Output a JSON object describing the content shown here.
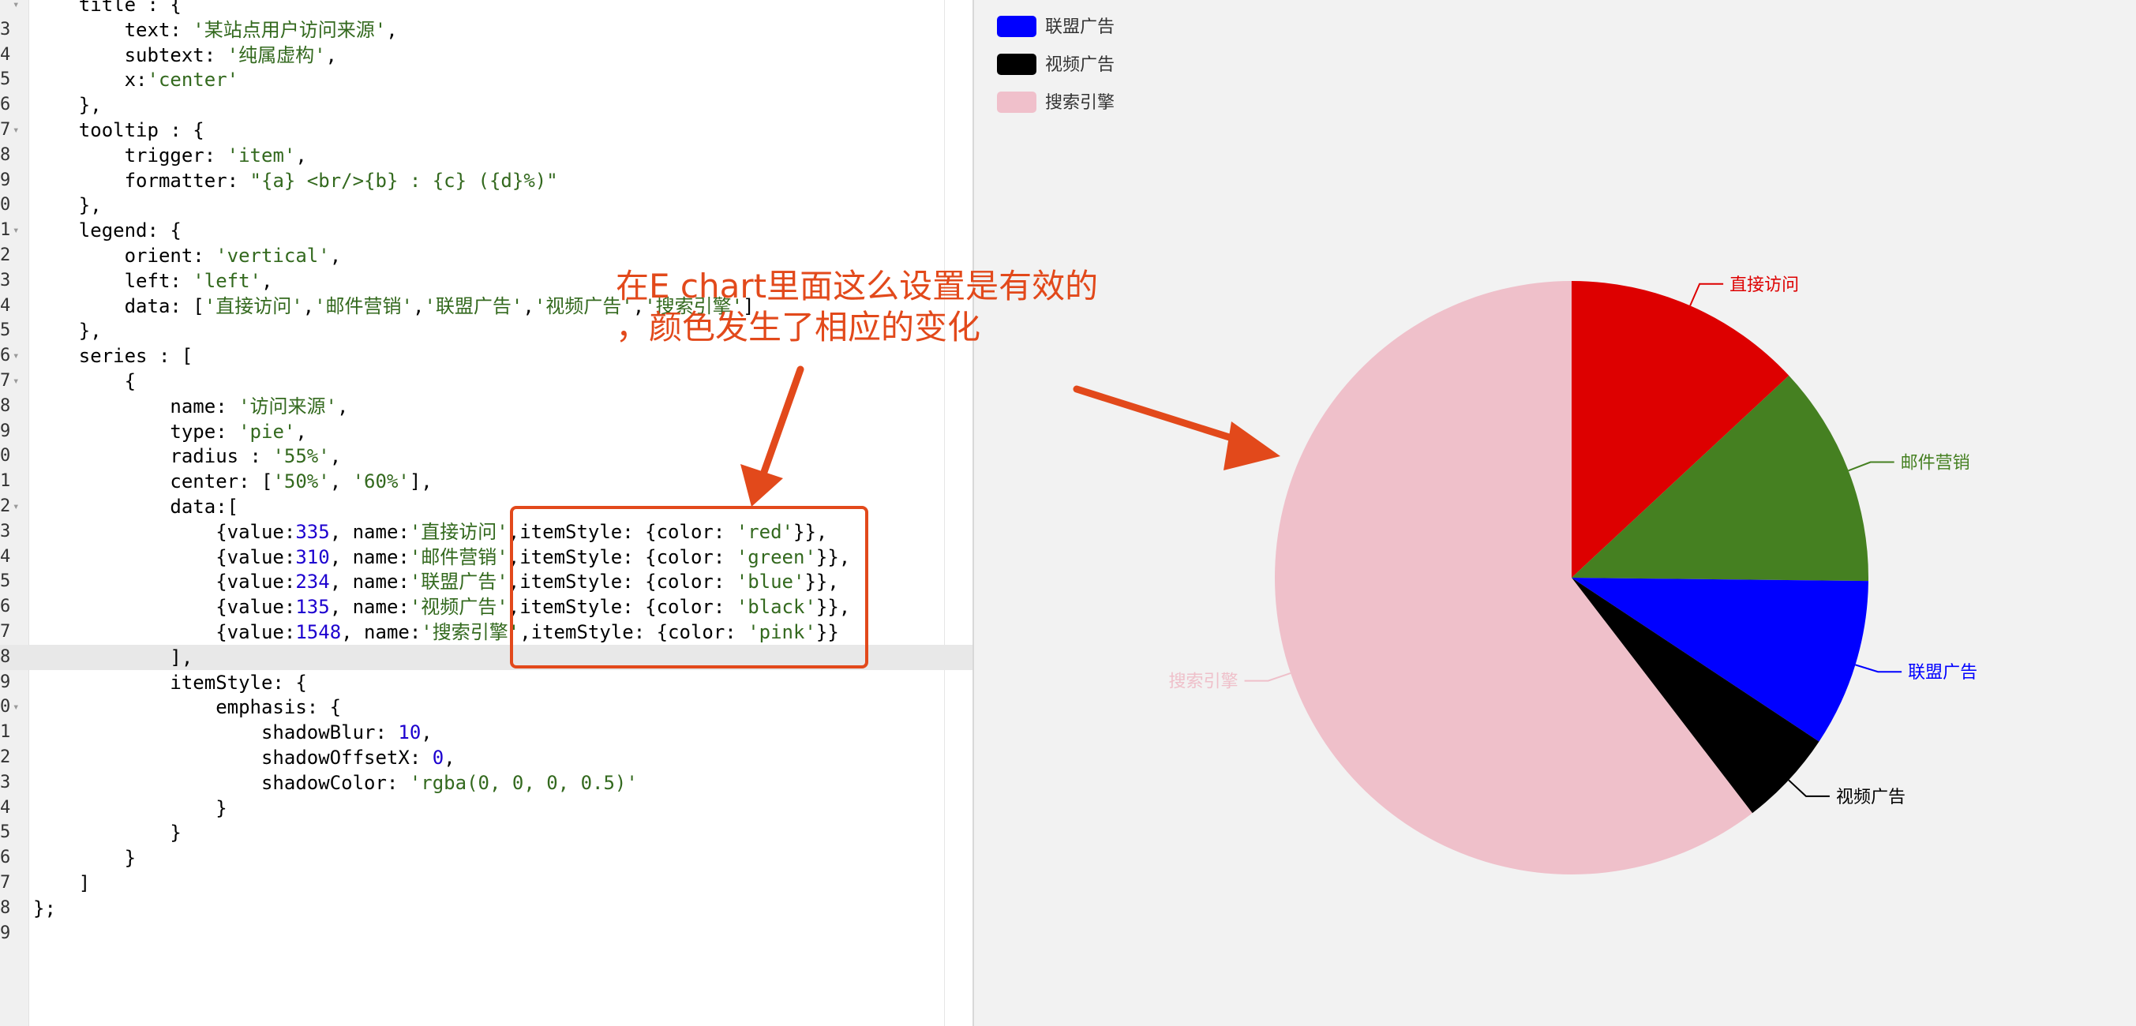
{
  "editor": {
    "lines": [
      {
        "no": "",
        "fold": true,
        "segs": [
          {
            "t": "    title : {"
          }
        ]
      },
      {
        "no": "3",
        "segs": [
          {
            "t": "        text: "
          },
          {
            "t": "'某站点用户访问来源'",
            "c": "str"
          },
          {
            "t": ","
          }
        ]
      },
      {
        "no": "4",
        "segs": [
          {
            "t": "        subtext: "
          },
          {
            "t": "'纯属虚构'",
            "c": "str"
          },
          {
            "t": ","
          }
        ]
      },
      {
        "no": "5",
        "segs": [
          {
            "t": "        x:"
          },
          {
            "t": "'center'",
            "c": "str"
          }
        ]
      },
      {
        "no": "6",
        "segs": [
          {
            "t": "    },"
          }
        ]
      },
      {
        "no": "7",
        "fold": true,
        "segs": [
          {
            "t": "    tooltip : {"
          }
        ]
      },
      {
        "no": "8",
        "segs": [
          {
            "t": "        trigger: "
          },
          {
            "t": "'item'",
            "c": "str"
          },
          {
            "t": ","
          }
        ]
      },
      {
        "no": "9",
        "segs": [
          {
            "t": "        formatter: "
          },
          {
            "t": "\"{a} <br/>{b} : {c} ({d}%)\"",
            "c": "str"
          }
        ]
      },
      {
        "no": "0",
        "segs": [
          {
            "t": "    },"
          }
        ]
      },
      {
        "no": "1",
        "fold": true,
        "segs": [
          {
            "t": "    legend: {"
          }
        ]
      },
      {
        "no": "2",
        "segs": [
          {
            "t": "        orient: "
          },
          {
            "t": "'vertical'",
            "c": "str"
          },
          {
            "t": ","
          }
        ]
      },
      {
        "no": "3",
        "segs": [
          {
            "t": "        left: "
          },
          {
            "t": "'left'",
            "c": "str"
          },
          {
            "t": ","
          }
        ]
      },
      {
        "no": "4",
        "segs": [
          {
            "t": "        data: ["
          },
          {
            "t": "'直接访问'",
            "c": "str"
          },
          {
            "t": ","
          },
          {
            "t": "'邮件营销'",
            "c": "str"
          },
          {
            "t": ","
          },
          {
            "t": "'联盟广告'",
            "c": "str"
          },
          {
            "t": ","
          },
          {
            "t": "'视频广告'",
            "c": "str"
          },
          {
            "t": ","
          },
          {
            "t": "'搜索引擎'",
            "c": "str"
          },
          {
            "t": "]"
          }
        ]
      },
      {
        "no": "5",
        "segs": [
          {
            "t": "    },"
          }
        ]
      },
      {
        "no": "6",
        "fold": true,
        "segs": [
          {
            "t": "    series : ["
          }
        ]
      },
      {
        "no": "7",
        "fold": true,
        "segs": [
          {
            "t": "        {"
          }
        ]
      },
      {
        "no": "8",
        "segs": [
          {
            "t": "            name: "
          },
          {
            "t": "'访问来源'",
            "c": "str"
          },
          {
            "t": ","
          }
        ]
      },
      {
        "no": "9",
        "segs": [
          {
            "t": "            type: "
          },
          {
            "t": "'pie'",
            "c": "str"
          },
          {
            "t": ","
          }
        ]
      },
      {
        "no": "0",
        "segs": [
          {
            "t": "            radius : "
          },
          {
            "t": "'55%'",
            "c": "str"
          },
          {
            "t": ","
          }
        ]
      },
      {
        "no": "1",
        "segs": [
          {
            "t": "            center: ["
          },
          {
            "t": "'50%'",
            "c": "str"
          },
          {
            "t": ", "
          },
          {
            "t": "'60%'",
            "c": "str"
          },
          {
            "t": "],"
          }
        ]
      },
      {
        "no": "2",
        "fold": true,
        "segs": [
          {
            "t": "            data:["
          }
        ]
      },
      {
        "no": "3",
        "segs": [
          {
            "t": "                {value:"
          },
          {
            "t": "335",
            "c": "num"
          },
          {
            "t": ", name:"
          },
          {
            "t": "'直接访问'",
            "c": "str"
          },
          {
            "t": ",itemStyle: {color: "
          },
          {
            "t": "'red'",
            "c": "str"
          },
          {
            "t": "}},"
          }
        ]
      },
      {
        "no": "4",
        "segs": [
          {
            "t": "                {value:"
          },
          {
            "t": "310",
            "c": "num"
          },
          {
            "t": ", name:"
          },
          {
            "t": "'邮件营销'",
            "c": "str"
          },
          {
            "t": ",itemStyle: {color: "
          },
          {
            "t": "'green'",
            "c": "str"
          },
          {
            "t": "}},"
          }
        ]
      },
      {
        "no": "5",
        "segs": [
          {
            "t": "                {value:"
          },
          {
            "t": "234",
            "c": "num"
          },
          {
            "t": ", name:"
          },
          {
            "t": "'联盟广告'",
            "c": "str"
          },
          {
            "t": ",itemStyle: {color: "
          },
          {
            "t": "'blue'",
            "c": "str"
          },
          {
            "t": "}},"
          }
        ]
      },
      {
        "no": "6",
        "segs": [
          {
            "t": "                {value:"
          },
          {
            "t": "135",
            "c": "num"
          },
          {
            "t": ", name:"
          },
          {
            "t": "'视频广告'",
            "c": "str"
          },
          {
            "t": ",itemStyle: {color: "
          },
          {
            "t": "'black'",
            "c": "str"
          },
          {
            "t": "}},"
          }
        ]
      },
      {
        "no": "7",
        "segs": [
          {
            "t": "                {value:"
          },
          {
            "t": "1548",
            "c": "num"
          },
          {
            "t": ", name:"
          },
          {
            "t": "'搜索引擎'",
            "c": "str"
          },
          {
            "t": ",itemStyle: {color: "
          },
          {
            "t": "'pink'",
            "c": "str"
          },
          {
            "t": "}}"
          }
        ]
      },
      {
        "no": "8",
        "current": true,
        "segs": [
          {
            "t": "            ],"
          }
        ]
      },
      {
        "no": "9",
        "segs": [
          {
            "t": "            itemStyle: {"
          }
        ]
      },
      {
        "no": "0",
        "fold": true,
        "segs": [
          {
            "t": "                emphasis: {"
          }
        ]
      },
      {
        "no": "1",
        "segs": [
          {
            "t": "                    shadowBlur: "
          },
          {
            "t": "10",
            "c": "num"
          },
          {
            "t": ","
          }
        ]
      },
      {
        "no": "2",
        "segs": [
          {
            "t": "                    shadowOffsetX: "
          },
          {
            "t": "0",
            "c": "num"
          },
          {
            "t": ","
          }
        ]
      },
      {
        "no": "3",
        "segs": [
          {
            "t": "                    shadowColor: "
          },
          {
            "t": "'rgba(0, 0, 0, 0.5)'",
            "c": "str"
          }
        ]
      },
      {
        "no": "4",
        "segs": [
          {
            "t": "                }"
          }
        ]
      },
      {
        "no": "5",
        "segs": [
          {
            "t": "            }"
          }
        ]
      },
      {
        "no": "6",
        "segs": [
          {
            "t": "        }"
          }
        ]
      },
      {
        "no": "7",
        "segs": [
          {
            "t": "    ]"
          }
        ]
      },
      {
        "no": "8",
        "segs": [
          {
            "t": "};"
          }
        ]
      },
      {
        "no": "9",
        "segs": [
          {
            "t": ""
          }
        ]
      }
    ]
  },
  "annotation": {
    "line1": "在E chart里面这么设置是有效的",
    "line2": "，颜色发生了相应的变化",
    "color": "#e2491b"
  },
  "chart_data": {
    "type": "pie",
    "legend_position": "top-left",
    "legend": [
      {
        "name": "联盟广告",
        "color": "#0000ff"
      },
      {
        "name": "视频广告",
        "color": "#000000"
      },
      {
        "name": "搜索引擎",
        "color": "#f0c0cb"
      }
    ],
    "slices": [
      {
        "name": "直接访问",
        "value": 335,
        "color": "#dd0000"
      },
      {
        "name": "邮件营销",
        "value": 310,
        "color": "#458021"
      },
      {
        "name": "联盟广告",
        "value": 234,
        "color": "#0000ff"
      },
      {
        "name": "视频广告",
        "value": 135,
        "color": "#000000"
      },
      {
        "name": "搜索引擎",
        "value": 1548,
        "color": "#efc0ca"
      }
    ]
  }
}
